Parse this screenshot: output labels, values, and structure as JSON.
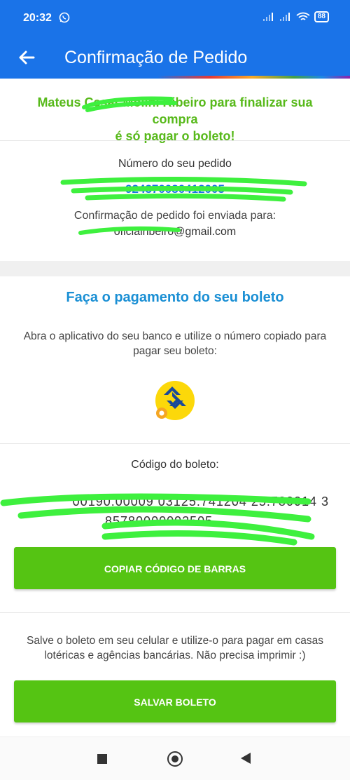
{
  "status_bar": {
    "time": "20:32",
    "battery": "88",
    "icons": [
      "whatsapp-icon",
      "signal-icon",
      "signal-icon",
      "wifi-icon",
      "battery-icon"
    ]
  },
  "app_bar": {
    "title": "Confirmação de Pedido",
    "back_icon": "arrow-left-icon",
    "color": "#1a73e8"
  },
  "greeting": {
    "line1": "Mateus Cesar Molini Ribeiro para finalizar sua compra",
    "line2": "é só pagar o boleto!",
    "color": "#57b91a"
  },
  "order": {
    "label": "Número do seu pedido",
    "number": "924370030412005",
    "sent_label": "Confirmação de pedido foi enviada para:",
    "email": "oficialribeiro@gmail.com",
    "number_color": "#1a73e8"
  },
  "payment": {
    "title": "Faça o pagamento do seu boleto",
    "description": "Abra o aplicativo do seu banco e utilize o número copiado para pagar seu boleto:",
    "bank_logo": "banco-do-brasil-logo",
    "title_color": "#1a8fd4"
  },
  "boleto": {
    "code_label": "Código do boleto:",
    "code_line1": "00190.00009 03125.741204 25.780014 3",
    "code_line2": "85780000092505",
    "copy_button": "COPIAR CÓDIGO DE BARRAS"
  },
  "save": {
    "description": "Salve o boleto em seu celular e utilize-o para pagar em casas lotéricas e agências bancárias. Não precisa imprimir :)",
    "button": "SALVAR BOLETO",
    "button_color": "#55c413"
  },
  "nav": {
    "icons": [
      "recents-icon",
      "home-icon",
      "back-icon"
    ]
  }
}
